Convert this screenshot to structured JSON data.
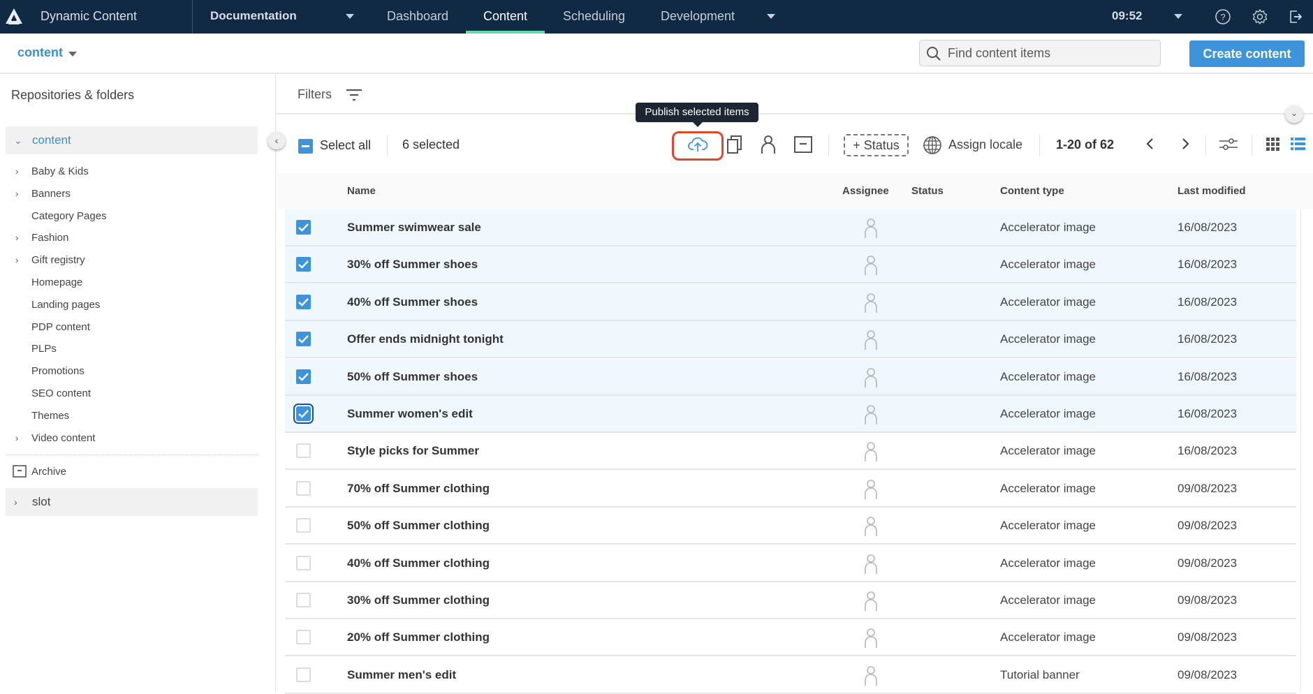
{
  "header": {
    "app_title": "Dynamic Content",
    "hub_name": "Documentation",
    "nav": [
      {
        "label": "Dashboard",
        "active": false
      },
      {
        "label": "Content",
        "active": true
      },
      {
        "label": "Scheduling",
        "active": false
      },
      {
        "label": "Development",
        "active": false
      }
    ],
    "clock": "09:52",
    "icons": [
      "help-icon",
      "settings-icon",
      "logout-icon"
    ],
    "accent_color": "#5fd9b0",
    "background_color": "#102a43"
  },
  "subbar": {
    "repository_switch": "content",
    "search_placeholder": "Find content items",
    "search_value": "",
    "create_button": "Create content",
    "primary_color": "#3e94db"
  },
  "sidebar": {
    "title": "Repositories & folders",
    "repository": "content",
    "folders": [
      {
        "label": "Baby & Kids",
        "has_children": true
      },
      {
        "label": "Banners",
        "has_children": true
      },
      {
        "label": "Category Pages",
        "has_children": false
      },
      {
        "label": "Fashion",
        "has_children": true
      },
      {
        "label": "Gift registry",
        "has_children": true
      },
      {
        "label": "Homepage",
        "has_children": false
      },
      {
        "label": "Landing pages",
        "has_children": false
      },
      {
        "label": "PDP content",
        "has_children": false
      },
      {
        "label": "PLPs",
        "has_children": false
      },
      {
        "label": "Promotions",
        "has_children": false
      },
      {
        "label": "SEO content",
        "has_children": false
      },
      {
        "label": "Themes",
        "has_children": false
      },
      {
        "label": "Video content",
        "has_children": true
      }
    ],
    "archive": "Archive",
    "other_repository": "slot"
  },
  "filters": {
    "label": "Filters"
  },
  "toolbar": {
    "select_all": "Select all",
    "selected_count": "6 selected",
    "tooltip": "Publish selected items",
    "status_button": "+ Status",
    "assign_locale": "Assign locale",
    "pagination": "1-20 of 62",
    "highlight_color": "#e0462b"
  },
  "table": {
    "columns": [
      "Name",
      "Assignee",
      "Status",
      "Content type",
      "Last modified"
    ],
    "rows": [
      {
        "name": "Summer swimwear sale",
        "status": "",
        "content_type": "Accelerator image",
        "last_modified": "16/08/2023",
        "selected": true
      },
      {
        "name": "30% off Summer shoes",
        "status": "",
        "content_type": "Accelerator image",
        "last_modified": "16/08/2023",
        "selected": true
      },
      {
        "name": "40% off Summer shoes",
        "status": "",
        "content_type": "Accelerator image",
        "last_modified": "16/08/2023",
        "selected": true
      },
      {
        "name": "Offer ends midnight tonight",
        "status": "",
        "content_type": "Accelerator image",
        "last_modified": "16/08/2023",
        "selected": true
      },
      {
        "name": "50% off Summer shoes",
        "status": "",
        "content_type": "Accelerator image",
        "last_modified": "16/08/2023",
        "selected": true
      },
      {
        "name": "Summer women's edit",
        "status": "",
        "content_type": "Accelerator image",
        "last_modified": "16/08/2023",
        "selected": true
      },
      {
        "name": "Style picks for Summer",
        "status": "",
        "content_type": "Accelerator image",
        "last_modified": "16/08/2023",
        "selected": false
      },
      {
        "name": "70% off Summer clothing",
        "status": "",
        "content_type": "Accelerator image",
        "last_modified": "09/08/2023",
        "selected": false
      },
      {
        "name": "50% off Summer clothing",
        "status": "",
        "content_type": "Accelerator image",
        "last_modified": "09/08/2023",
        "selected": false
      },
      {
        "name": "40% off Summer clothing",
        "status": "",
        "content_type": "Accelerator image",
        "last_modified": "09/08/2023",
        "selected": false
      },
      {
        "name": "30% off Summer clothing",
        "status": "",
        "content_type": "Accelerator image",
        "last_modified": "09/08/2023",
        "selected": false
      },
      {
        "name": "20% off Summer clothing",
        "status": "",
        "content_type": "Accelerator image",
        "last_modified": "09/08/2023",
        "selected": false
      },
      {
        "name": "Summer men's edit",
        "status": "",
        "content_type": "Tutorial banner",
        "last_modified": "09/08/2023",
        "selected": false
      }
    ]
  }
}
